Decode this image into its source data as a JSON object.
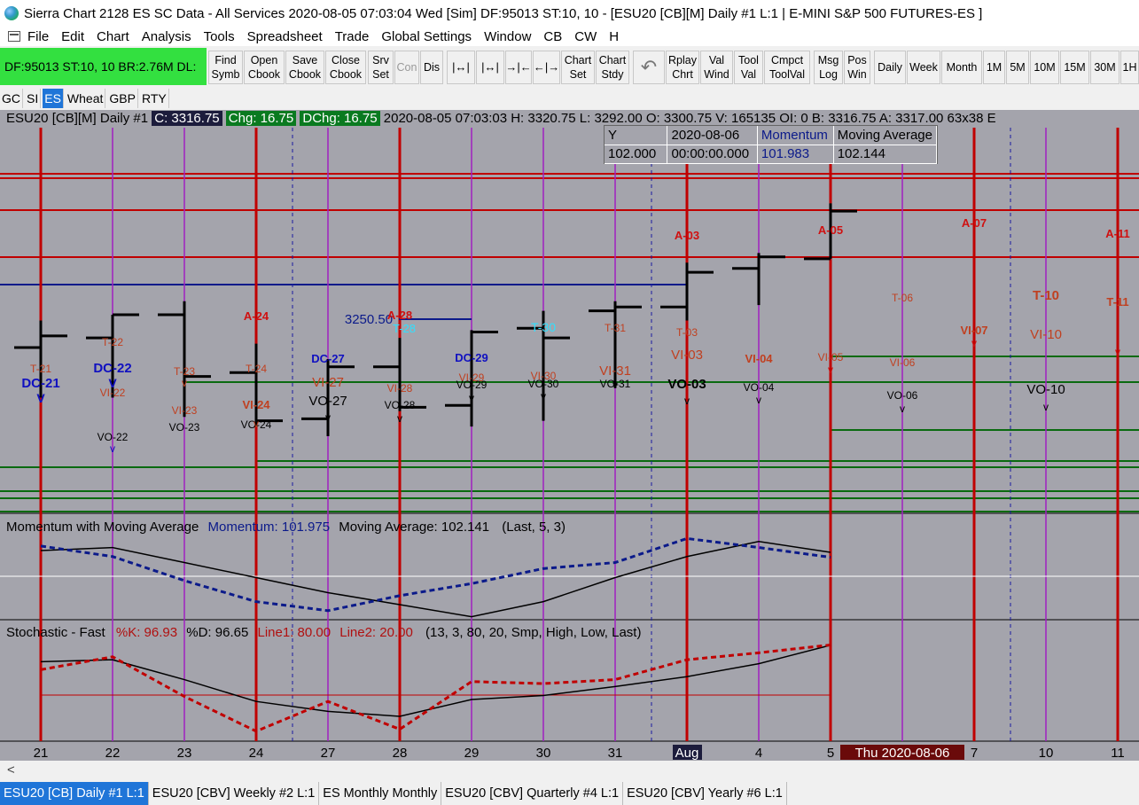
{
  "window": {
    "title": "Sierra Chart 2128 ES  SC Data - All Services 2020-08-05  07:03:04 Wed [Sim]  DF:95013  ST:10, 10 - [ESU20 [CB][M]  Daily  #1  L:1 | E-MINI S&P 500 FUTURES-ES ]"
  },
  "menu": [
    "File",
    "Edit",
    "Chart",
    "Analysis",
    "Tools",
    "Spreadsheet",
    "Trade",
    "Global Settings",
    "Window",
    "CB",
    "CW",
    "H"
  ],
  "status": {
    "text": "DF:95013  ST:10, 10   BR:2.76M  DL:"
  },
  "toolbar": [
    {
      "l1": "Find",
      "l2": "Symb"
    },
    {
      "l1": "Open",
      "l2": "Cbook"
    },
    {
      "l1": "Save",
      "l2": "Cbook"
    },
    {
      "l1": "Close",
      "l2": "Cbook"
    },
    {
      "l1": "Srv",
      "l2": "Set"
    },
    {
      "l1": "Con",
      "l2": ""
    },
    {
      "l1": "Dis",
      "l2": ""
    },
    {
      "l1": "Chart",
      "l2": "Set"
    },
    {
      "l1": "Chart",
      "l2": "Stdy"
    },
    {
      "l1": "Rplay",
      "l2": "Chrt"
    },
    {
      "l1": "Val",
      "l2": "Wind"
    },
    {
      "l1": "Tool",
      "l2": "Val"
    },
    {
      "l1": "Cmpct",
      "l2": "ToolVal"
    },
    {
      "l1": "Msg",
      "l2": "Log"
    },
    {
      "l1": "Pos",
      "l2": "Win"
    },
    {
      "l1": "Daily",
      "l2": ""
    },
    {
      "l1": "Week",
      "l2": ""
    },
    {
      "l1": "Month",
      "l2": ""
    },
    {
      "l1": "1M",
      "l2": ""
    },
    {
      "l1": "5M",
      "l2": ""
    },
    {
      "l1": "10M",
      "l2": ""
    },
    {
      "l1": "15M",
      "l2": ""
    },
    {
      "l1": "30M",
      "l2": ""
    },
    {
      "l1": "1H",
      "l2": ""
    }
  ],
  "symbols": [
    "GC",
    "SI",
    "ES",
    "Wheat",
    "GBP",
    "RTY"
  ],
  "active_symbol": "ES",
  "header": {
    "symbol": "ESU20 [CB][M]  Daily  #1",
    "close": "C: 3316.75",
    "chg": "Chg: 16.75",
    "dchg": "DChg: 16.75",
    "rest": "2020-08-05 07:03:03 H: 3320.75  L: 3292.00  O: 3300.75  V: 165135  OI: 0  B: 3316.75  A: 3317.00  63x38  E"
  },
  "popup": {
    "row1": [
      "Y",
      "2020-08-06",
      "Momentum",
      "Moving Average"
    ],
    "row2": [
      "102.000",
      "00:00:00.000",
      "101.983",
      "102.144"
    ]
  },
  "studies": {
    "momentum": {
      "name": "Momentum with Moving Average",
      "v1": "Momentum: 101.975",
      "v2": "Moving Average: 102.141",
      "args": "(Last, 5, 3)"
    },
    "stoch": {
      "name": "Stochastic - Fast",
      "k": "%K: 96.93",
      "d": "%D: 96.65",
      "l1": "Line1: 80.00",
      "l2": "Line2: 20.00",
      "args": "(13, 3, 80, 20, Smp, High, Low, Last)"
    }
  },
  "price_label": "3250.50",
  "xaxis": {
    "labels": [
      "21",
      "22",
      "23",
      "24",
      "27",
      "28",
      "29",
      "30",
      "31",
      "Aug",
      "4",
      "5",
      "Thu 2020-08-06",
      "7",
      "10",
      "11"
    ]
  },
  "chart_data": {
    "type": "ohlc",
    "dates": [
      "07-21",
      "07-22",
      "07-23",
      "07-24",
      "07-27",
      "07-28",
      "07-29",
      "07-30",
      "07-31",
      "08-03",
      "08-04",
      "08-05"
    ],
    "bars": [
      {
        "o": 3246,
        "h": 3260,
        "l": 3220,
        "c": 3252
      },
      {
        "o": 3251,
        "h": 3263,
        "l": 3220,
        "c": 3263
      },
      {
        "o": 3263,
        "h": 3270,
        "l": 3210,
        "c": 3231
      },
      {
        "o": 3233,
        "h": 3248,
        "l": 3205,
        "c": 3208
      },
      {
        "o": 3209,
        "h": 3240,
        "l": 3200,
        "c": 3236
      },
      {
        "o": 3236,
        "h": 3251,
        "l": 3213,
        "c": 3215
      },
      {
        "o": 3216,
        "h": 3255,
        "l": 3205,
        "c": 3254
      },
      {
        "o": 3256,
        "h": 3265,
        "l": 3208,
        "c": 3251
      },
      {
        "o": 3265,
        "h": 3270,
        "l": 3225,
        "c": 3267
      },
      {
        "o": 3267,
        "h": 3290,
        "l": 3260,
        "c": 3285
      },
      {
        "o": 3287,
        "h": 3295,
        "l": 3268,
        "c": 3293
      },
      {
        "o": 3292,
        "h": 3320.75,
        "l": 3292,
        "c": 3316.75
      }
    ],
    "momentum": [
      102.35,
      102.0,
      101.2,
      100.5,
      100.2,
      100.7,
      101.1,
      101.6,
      101.8,
      102.6,
      102.3,
      101.975
    ],
    "momentum_ma": [
      102.2,
      102.3,
      101.8,
      101.3,
      100.8,
      100.4,
      100.0,
      100.5,
      101.3,
      102.0,
      102.5,
      102.141
    ],
    "stoch_k": [
      72,
      85,
      45,
      10,
      40,
      12,
      60,
      58,
      62,
      82,
      89,
      96.93
    ],
    "stoch_d": [
      80,
      82,
      62,
      40,
      30,
      25,
      42,
      46,
      55,
      65,
      78,
      96.65
    ],
    "stoch_lines": [
      80,
      20
    ]
  }
}
